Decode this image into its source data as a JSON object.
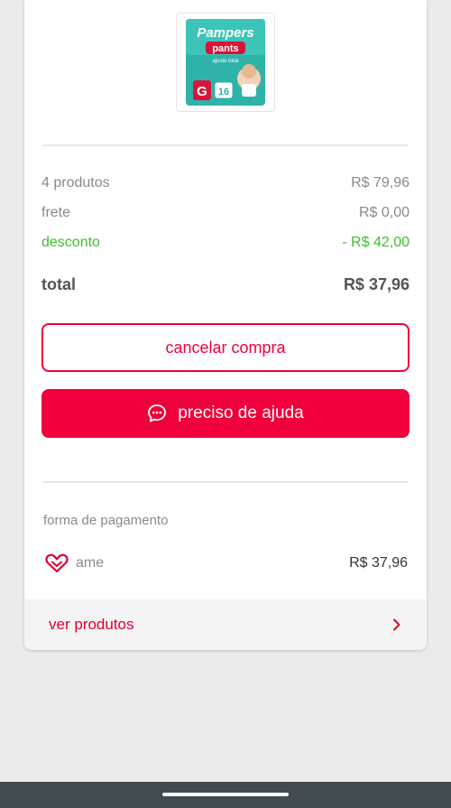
{
  "product": {
    "brand": "Pampers",
    "line": "pants",
    "tagline": "ajuste total",
    "size": "G",
    "count": "16"
  },
  "summary": {
    "items_label": "4 produtos",
    "items_value": "R$ 79,96",
    "shipping_label": "frete",
    "shipping_value": "R$ 0,00",
    "discount_label": "desconto",
    "discount_value": "- R$ 42,00",
    "total_label": "total",
    "total_value": "R$ 37,96"
  },
  "actions": {
    "cancel_label": "cancelar compra",
    "help_label": "preciso de ajuda"
  },
  "payment": {
    "title": "forma de pagamento",
    "method": "ame",
    "method_icon": "heart-icon",
    "amount": "R$ 37,96"
  },
  "footer": {
    "link_label": "ver produtos",
    "link_icon": "chevron-right-icon"
  },
  "colors": {
    "accent": "#f0003c",
    "discount": "#3cbf2a",
    "background": "#ebebeb",
    "navbar": "#424b50"
  }
}
